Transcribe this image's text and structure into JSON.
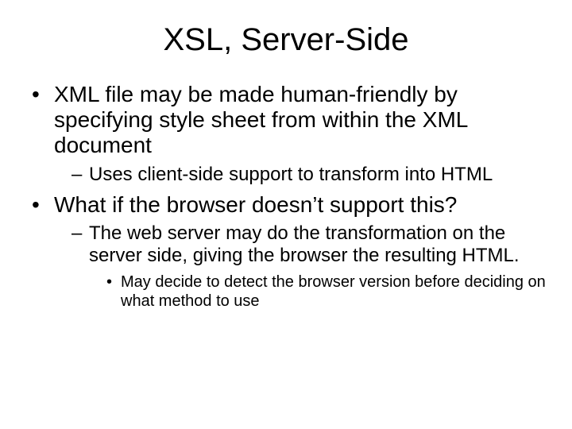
{
  "slide": {
    "title": "XSL, Server-Side",
    "bullets": [
      {
        "text": "XML file may be made human-friendly by specifying style sheet from within the XML document",
        "children": [
          {
            "text": "Uses client-side support to transform into HTML",
            "children": []
          }
        ]
      },
      {
        "text": "What if the browser doesn’t support this?",
        "children": [
          {
            "text": "The web server may do the transformation on the server side, giving the browser the resulting HTML.",
            "children": [
              {
                "text": "May decide to detect the browser version before deciding on what method to use"
              }
            ]
          }
        ]
      }
    ]
  }
}
